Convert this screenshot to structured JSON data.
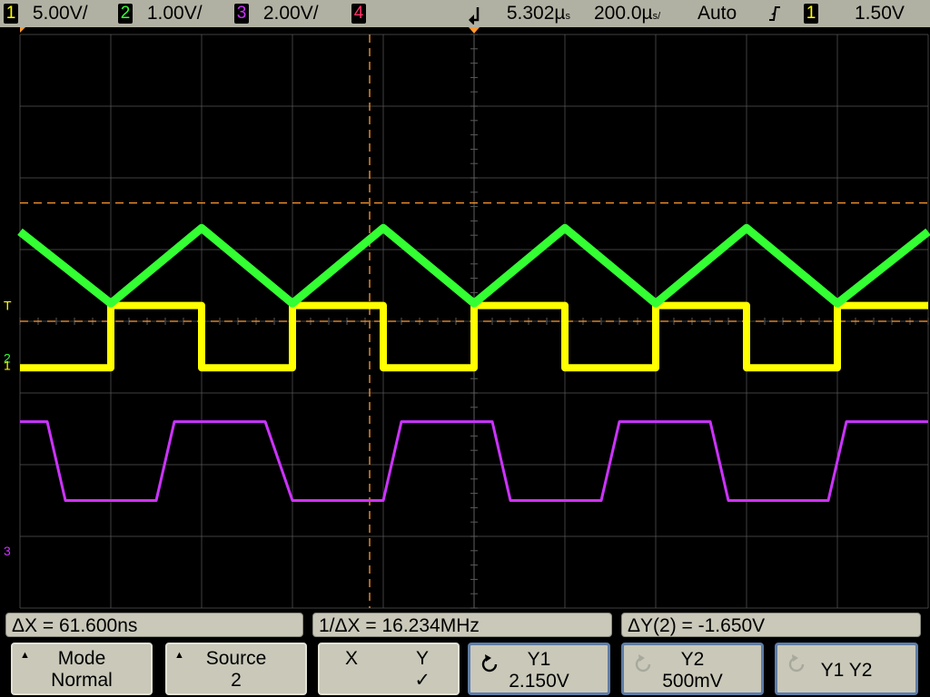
{
  "topbar": {
    "ch1_num": "1",
    "ch1_scale": "5.00V/",
    "ch2_num": "2",
    "ch2_scale": "1.00V/",
    "ch3_num": "3",
    "ch3_scale": "2.00V/",
    "ch4_num": "4",
    "delay": "5.302µ",
    "delay_suffix": "s",
    "timebase": "200.0µ",
    "timebase_suffix": "s/",
    "trigger_mode": "Auto",
    "trigger_slope_icon": "rising-edge-icon",
    "trigger_source": "1",
    "trigger_level": "1.50V"
  },
  "colors": {
    "ch1": "#ffff00",
    "ch2": "#33ff33",
    "ch3": "#cc33ff",
    "ch4": "#ff3366",
    "cursor": "#ff9933",
    "graticule": "#5a5a5a"
  },
  "markers": {
    "trigger_level": "T",
    "ch2_ground": "2",
    "ch1_ground": "1",
    "ch3_ground": "3"
  },
  "readouts": {
    "delta_x": "ΔX = 61.600ns",
    "inv_delta_x": "1/ΔX = 16.234MHz",
    "delta_y": "ΔY(2) = -1.650V"
  },
  "softkeys": [
    {
      "line1": "Mode",
      "line2": "Normal",
      "icon": "up-triangle-icon"
    },
    {
      "line1": "Source",
      "line2": "2",
      "icon": "up-triangle-icon"
    },
    {
      "line1": "X",
      "line1b": "Y",
      "line2": "✓"
    },
    {
      "line1": "Y1",
      "line2": "2.150V",
      "icon": "rotate-knob-icon"
    },
    {
      "line1": "Y2",
      "line2": "500mV",
      "icon": "rotate-knob-icon"
    },
    {
      "line1": "Y1 Y2",
      "line2": "",
      "icon": "rotate-knob-icon"
    }
  ],
  "chart_data": {
    "type": "line",
    "title": "",
    "xlabel": "",
    "ylabel": "",
    "grid": true,
    "xlim": [
      -5,
      5
    ],
    "ylim": [
      -4,
      4
    ],
    "x_units": "divisions",
    "y_units": "divisions",
    "series": [
      {
        "name": "1",
        "values": [
          [
            -5.0,
            -0.65
          ],
          [
            -4.0,
            -0.65
          ],
          [
            -4.0,
            0.22
          ],
          [
            -3.0,
            0.22
          ],
          [
            -3.0,
            -0.65
          ],
          [
            -2.0,
            -0.65
          ],
          [
            -2.0,
            0.22
          ],
          [
            -1.0,
            0.22
          ],
          [
            -1.0,
            -0.65
          ],
          [
            0.0,
            -0.65
          ],
          [
            0.0,
            0.22
          ],
          [
            1.0,
            0.22
          ],
          [
            1.0,
            -0.65
          ],
          [
            2.0,
            -0.65
          ],
          [
            2.0,
            0.22
          ],
          [
            3.0,
            0.22
          ],
          [
            3.0,
            -0.65
          ],
          [
            4.0,
            -0.65
          ],
          [
            4.0,
            0.22
          ],
          [
            5.0,
            0.22
          ]
        ]
      },
      {
        "name": "2",
        "values": [
          [
            -5.0,
            1.25
          ],
          [
            -4.5,
            0.75
          ],
          [
            -4.0,
            0.25
          ],
          [
            -3.0,
            1.3
          ],
          [
            -2.0,
            0.25
          ],
          [
            -1.0,
            1.3
          ],
          [
            0.0,
            0.25
          ],
          [
            1.0,
            1.3
          ],
          [
            2.0,
            0.25
          ],
          [
            3.0,
            1.3
          ],
          [
            4.0,
            0.25
          ],
          [
            5.0,
            1.25
          ]
        ]
      },
      {
        "name": "3",
        "values": [
          [
            -5.0,
            -1.4
          ],
          [
            -4.7,
            -1.4
          ],
          [
            -4.5,
            -2.5
          ],
          [
            -3.5,
            -2.5
          ],
          [
            -3.3,
            -1.4
          ],
          [
            -2.3,
            -1.4
          ],
          [
            -2.0,
            -2.5
          ],
          [
            -1.0,
            -2.5
          ],
          [
            -0.8,
            -1.4
          ],
          [
            0.2,
            -1.4
          ],
          [
            0.4,
            -2.5
          ],
          [
            1.4,
            -2.5
          ],
          [
            1.6,
            -1.4
          ],
          [
            2.6,
            -1.4
          ],
          [
            2.8,
            -2.5
          ],
          [
            3.9,
            -2.5
          ],
          [
            4.1,
            -1.4
          ],
          [
            5.0,
            -1.4
          ]
        ]
      }
    ],
    "cursors": {
      "x1_div": -1.15,
      "y1_div": 1.65,
      "y2_div": 0.0
    }
  }
}
